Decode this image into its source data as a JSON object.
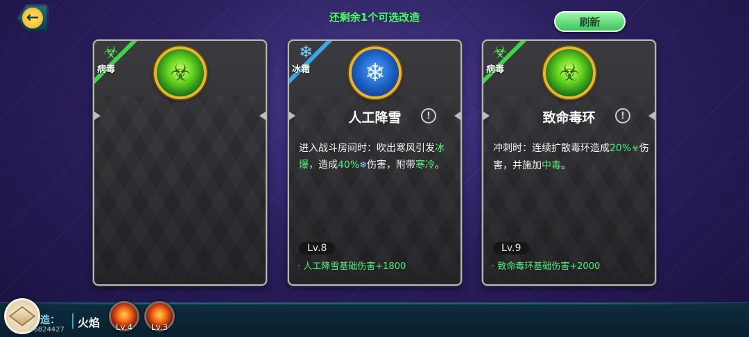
{
  "header": {
    "remaining_text": "还剩余1个可选改造",
    "refresh_label": "刷新",
    "back_icon": "back-arrow-icon"
  },
  "cards": [
    {
      "tag": "病毒",
      "tag_icon": "biohazard-icon",
      "orb_icon": "virus-orb-icon",
      "name": "",
      "description": "",
      "level": "",
      "level_detail": ""
    },
    {
      "tag": "冰霜",
      "tag_icon": "snowflake-icon",
      "orb_icon": "snowflake-orb-icon",
      "name": "人工降雪",
      "desc_part1": "进入战斗房间时：吹出寒风引发",
      "desc_hl1": "冰爆",
      "desc_part2": "，造成",
      "desc_hl2": "40%",
      "desc_part3": "伤害，附带",
      "desc_hl3": "寒冷",
      "desc_part4": "。",
      "level": "Lv.8",
      "level_detail": "· 人工降雪基础伤害+1800"
    },
    {
      "tag": "病毒",
      "tag_icon": "biohazard-icon",
      "orb_icon": "virus-orb-icon",
      "name": "致命毒环",
      "desc_part1": "冲刺时：连续扩散毒环造成",
      "desc_hl1": "20%",
      "desc_part2": "伤害，并施加",
      "desc_hl2": "中毒",
      "desc_part3": "。",
      "level": "Lv.9",
      "level_detail": "· 致命毒环基础伤害+2000"
    }
  ],
  "bottom": {
    "cy_label": "造：",
    "player_id": "46824427",
    "fire_label": "火焰",
    "skills": [
      {
        "level": "Lv.4",
        "icon": "fire-skill-icon"
      },
      {
        "level": "Lv.3",
        "icon": "fire-skill-icon"
      }
    ]
  },
  "colors": {
    "highlight_green": "#52f07a",
    "virus_stripe": "#3fd24a",
    "frost_stripe": "#3aa7e8"
  }
}
